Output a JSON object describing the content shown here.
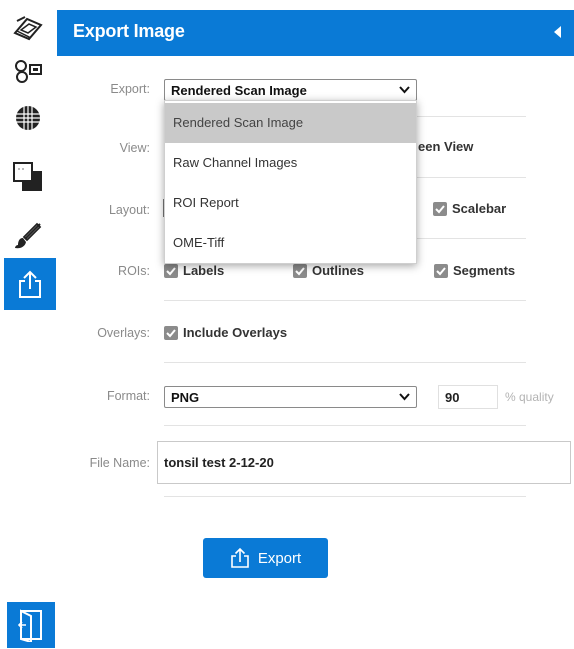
{
  "rail": {
    "tools": [
      {
        "name": "scanner-tool",
        "icon": "scanner-icon"
      },
      {
        "name": "channels-tool",
        "icon": "channels-icon"
      },
      {
        "name": "grid-tool",
        "icon": "globe-grid-icon"
      },
      {
        "name": "layers-tool",
        "icon": "layers-icon"
      },
      {
        "name": "annotate-tool",
        "icon": "paintbrush-icon"
      },
      {
        "name": "export-tool",
        "icon": "export-icon",
        "active": true
      }
    ],
    "bottom_icon": "exit-icon"
  },
  "panel": {
    "title": "Export Image",
    "colors": {
      "accent": "#0a7ad6",
      "checkbox": "#8b8b8b"
    },
    "export": {
      "label": "Export:",
      "selected": "Rendered Scan Image"
    },
    "dropdown": {
      "options": [
        "Rendered Scan Image",
        "Raw Channel Images",
        "ROI Report",
        "OME-Tiff"
      ],
      "highlighted_index": 0
    },
    "view": {
      "label": "View:",
      "visible_suffix": "een View"
    },
    "layout": {
      "label": "Layout:",
      "scalebar": "Scalebar"
    },
    "rois": {
      "label": "ROIs:",
      "labels": "Labels",
      "outlines": "Outlines",
      "segments": "Segments"
    },
    "overlays": {
      "label": "Overlays:",
      "include": "Include Overlays"
    },
    "format": {
      "label": "Format:",
      "selected": "PNG",
      "quality_value": "90",
      "quality_hint": "% quality"
    },
    "file_name": {
      "label": "File Name:",
      "value": "tonsil test 2-12-20"
    },
    "export_button": "Export"
  }
}
